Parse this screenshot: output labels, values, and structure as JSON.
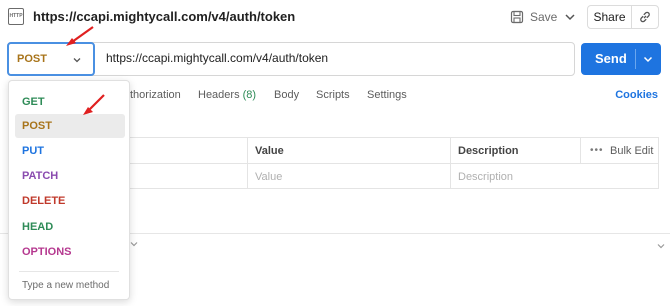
{
  "header": {
    "icon_text": "HTTP",
    "url_title": "https://ccapi.mightycall.com/v4/auth/token",
    "save_label": "Save",
    "share_label": "Share"
  },
  "request": {
    "method": "POST",
    "url": "https://ccapi.mightycall.com/v4/auth/token",
    "send_label": "Send"
  },
  "tabs": {
    "partial_first": "thorization",
    "headers_label": "Headers",
    "headers_count": "(8)",
    "body": "Body",
    "scripts": "Scripts",
    "settings": "Settings",
    "cookies": "Cookies"
  },
  "params_table": {
    "headers": [
      "Value",
      "Description",
      "Bulk Edit"
    ],
    "placeholders": [
      "Value",
      "Description"
    ]
  },
  "dropdown": {
    "items": [
      {
        "label": "GET",
        "color": "#2e8b57"
      },
      {
        "label": "POST",
        "color": "#a8741a"
      },
      {
        "label": "PUT",
        "color": "#1e74e0"
      },
      {
        "label": "PATCH",
        "color": "#8a4baf"
      },
      {
        "label": "DELETE",
        "color": "#c0392b"
      },
      {
        "label": "HEAD",
        "color": "#2e8b57"
      },
      {
        "label": "OPTIONS",
        "color": "#b5388f"
      }
    ],
    "selected": "POST",
    "new_method_placeholder": "Type a new method"
  },
  "colors": {
    "accent": "#1e74e0",
    "annotation_arrow": "#e02020"
  }
}
